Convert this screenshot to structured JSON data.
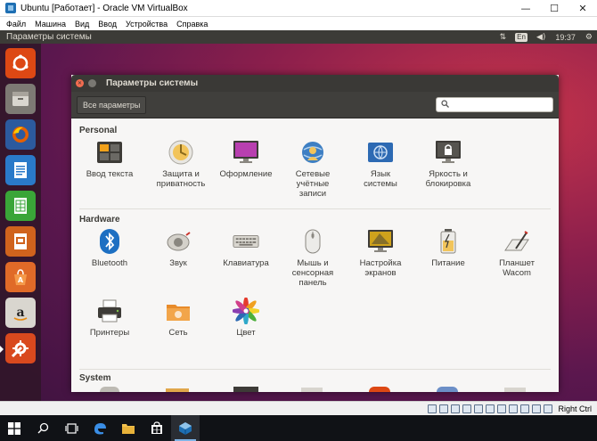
{
  "vbox": {
    "title": "Ubuntu [Работает] - Oracle VM VirtualBox",
    "menu": [
      "Файл",
      "Машина",
      "Вид",
      "Ввод",
      "Устройства",
      "Справка"
    ],
    "minimize": "—",
    "maximize": "☐",
    "close": "✕",
    "status_host_key": "Right Ctrl"
  },
  "ubuntu_panel": {
    "title": "Параметры системы",
    "lang": "En",
    "clock": "19:37"
  },
  "settings": {
    "window_title": "Параметры системы",
    "all_settings_label": "Все параметры",
    "search_placeholder": "",
    "sections": [
      {
        "title": "Personal",
        "items": [
          {
            "label": "Ввод текста",
            "icon": "text-entry-icon"
          },
          {
            "label": "Защита и\nприватность",
            "icon": "security-privacy-icon"
          },
          {
            "label": "Оформление",
            "icon": "appearance-icon"
          },
          {
            "label": "Сетевые\nучётные\nзаписи",
            "icon": "online-accounts-icon"
          },
          {
            "label": "Язык\nсистемы",
            "icon": "language-support-icon"
          },
          {
            "label": "Яркость и\nблокировка",
            "icon": "brightness-lock-icon"
          }
        ]
      },
      {
        "title": "Hardware",
        "items": [
          {
            "label": "Bluetooth",
            "icon": "bluetooth-icon"
          },
          {
            "label": "Звук",
            "icon": "sound-icon"
          },
          {
            "label": "Клавиатура",
            "icon": "keyboard-icon"
          },
          {
            "label": "Мышь и\nсенсорная\nпанель",
            "icon": "mouse-touchpad-icon"
          },
          {
            "label": "Настройка\nэкранов",
            "icon": "displays-icon"
          },
          {
            "label": "Питание",
            "icon": "power-icon"
          },
          {
            "label": "Планшет\nWacom",
            "icon": "wacom-tablet-icon"
          },
          {
            "label": "Принтеры",
            "icon": "printers-icon"
          },
          {
            "label": "Сеть",
            "icon": "network-icon"
          },
          {
            "label": "Цвет",
            "icon": "color-icon"
          }
        ]
      },
      {
        "title": "System",
        "items": []
      }
    ]
  },
  "launcher": {
    "items": [
      {
        "icon": "ubuntu-dash-icon",
        "color": "#dd4814"
      },
      {
        "icon": "files-icon",
        "color": "#8e8a82"
      },
      {
        "icon": "firefox-icon",
        "color": "#e66000"
      },
      {
        "icon": "libreoffice-writer-icon",
        "color": "#2a7ac9"
      },
      {
        "icon": "libreoffice-calc-icon",
        "color": "#3aa538"
      },
      {
        "icon": "libreoffice-impress-icon",
        "color": "#d0631d"
      },
      {
        "icon": "software-center-icon",
        "color": "#e06a28"
      },
      {
        "icon": "amazon-icon",
        "color": "#cb7a14"
      },
      {
        "icon": "system-settings-icon",
        "color": "#d9491e"
      }
    ]
  },
  "taskbar": {
    "items": [
      "start-icon",
      "search-icon",
      "task-view-icon",
      "edge-icon",
      "file-explorer-icon",
      "store-icon",
      "virtualbox-icon"
    ]
  }
}
